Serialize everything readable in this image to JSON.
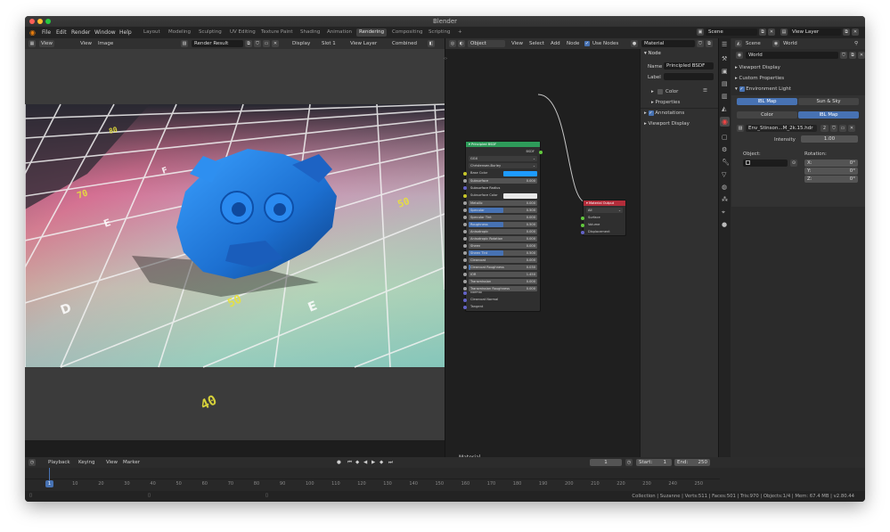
{
  "app": {
    "title": "Blender"
  },
  "menu": [
    "File",
    "Edit",
    "Render",
    "Window",
    "Help"
  ],
  "workspaces": [
    "Layout",
    "Modeling",
    "Sculpting",
    "UV Editing",
    "Texture Paint",
    "Shading",
    "Animation",
    "Rendering",
    "Compositing",
    "Scripting"
  ],
  "active_workspace": "Rendering",
  "top_right": {
    "scene": "Scene",
    "view_layer": "View Layer"
  },
  "image_editor": {
    "menus": [
      "View",
      "View",
      "Image"
    ],
    "image_name": "Render Result",
    "display": "Display",
    "slot": "Slot 1",
    "view_layer": "View Layer",
    "pass": "Combined"
  },
  "node_editor": {
    "type": "Object",
    "menus": [
      "View",
      "Select",
      "Add",
      "Node"
    ],
    "use_nodes_label": "Use Nodes",
    "use_nodes": true,
    "material": "Material",
    "footer_label": "Material",
    "bsdf_node": {
      "title": "Principled BSDF",
      "output": "BSDF",
      "distribution": "GGX",
      "subsurface_method": "Christensen-Burley",
      "base_color_label": "Base Color",
      "base_color": "#1e9bff",
      "subsurface_color_label": "Subsurface Color",
      "rows": [
        {
          "label": "Subsurface",
          "value": "0.000",
          "fill": 0
        },
        {
          "label": "Subsurface Radius",
          "value": "",
          "fill": 0
        },
        {
          "label": "Metallic",
          "value": "0.000",
          "fill": 0
        },
        {
          "label": "Specular",
          "value": "0.500",
          "fill": 0.5
        },
        {
          "label": "Specular Tint",
          "value": "0.000",
          "fill": 0
        },
        {
          "label": "Roughness",
          "value": "0.500",
          "fill": 0.5
        },
        {
          "label": "Anisotropic",
          "value": "0.000",
          "fill": 0
        },
        {
          "label": "Anisotropic Rotation",
          "value": "0.000",
          "fill": 0
        },
        {
          "label": "Sheen",
          "value": "0.000",
          "fill": 0
        },
        {
          "label": "Sheen Tint",
          "value": "0.500",
          "fill": 0.5
        },
        {
          "label": "Clearcoat",
          "value": "0.000",
          "fill": 0
        },
        {
          "label": "Clearcoat Roughness",
          "value": "0.030",
          "fill": 0.03
        },
        {
          "label": "IOR",
          "value": "1.450",
          "fill": 0
        },
        {
          "label": "Transmission",
          "value": "0.000",
          "fill": 0
        },
        {
          "label": "Transmission Roughness",
          "value": "0.000",
          "fill": 0
        }
      ],
      "inputs": [
        "Normal",
        "Clearcoat Normal",
        "Tangent"
      ]
    },
    "output_node": {
      "title": "Material Output",
      "target": "All",
      "inputs": [
        "Surface",
        "Volume",
        "Displacement"
      ]
    },
    "sidebar": {
      "panel": "Node",
      "name_label": "Name",
      "name": "Principled BSDF",
      "label_label": "Label",
      "label_value": "",
      "color_label": "Color",
      "properties_label": "Properties",
      "annotations_label": "Annotations",
      "viewport_display_label": "Viewport Display"
    }
  },
  "properties": {
    "scene": "Scene",
    "world": "World",
    "world_name": "World",
    "panels": [
      "Viewport Display",
      "Custom Properties",
      "Environment Light"
    ],
    "environment_light_enabled": true,
    "tabs_top": [
      "IBL Map",
      "Sun & Sky"
    ],
    "tabs_sub": [
      "Color",
      "IBL Map"
    ],
    "ibl_file": "Env_Stinson...M_2k.15.hdr",
    "ibl_users": "2",
    "intensity_label": "Intensity",
    "intensity": "1.00",
    "object_label": "Object:",
    "rotation_label": "Rotation:",
    "rotation": [
      {
        "axis": "X:",
        "value": "0°"
      },
      {
        "axis": "Y:",
        "value": "0°"
      },
      {
        "axis": "Z:",
        "value": "0°"
      }
    ]
  },
  "timeline": {
    "menus": [
      "Playback",
      "Keying",
      "View",
      "Marker"
    ],
    "current_frame": "1",
    "start_label": "Start:",
    "start": "1",
    "end_label": "End:",
    "end": "250",
    "ruler": [
      "10",
      "20",
      "30",
      "40",
      "50",
      "60",
      "70",
      "80",
      "90",
      "100",
      "110",
      "120",
      "130",
      "140",
      "150",
      "160",
      "170",
      "180",
      "190",
      "200",
      "210",
      "220",
      "230",
      "240",
      "250"
    ],
    "playhead": "1"
  },
  "status_bar": {
    "text": "Collection | Suzanne | Verts:511 | Faces:501 | Tris:970 | Objects:1/4 | Mem: 67.4 MB | v2.80.44"
  },
  "colors": {
    "accent": "#4772b3",
    "bsdf_header": "#2e9b5a",
    "output_header": "#b32d3a",
    "shader_socket": "#62c93e",
    "color_socket": "#c7c729",
    "vector_socket": "#6363c7",
    "value_socket": "#a1a1a1"
  },
  "icons": [
    "blender-logo-icon",
    "editor-type-icon",
    "image-icon",
    "new-image-icon",
    "open-image-icon",
    "close-icon",
    "node-tree-icon",
    "material-sphere-icon",
    "scene-icon",
    "world-icon",
    "pin-icon",
    "list-icon",
    "stop-icon",
    "play-icon",
    "jump-start-icon",
    "jump-end-icon",
    "prev-keyframe-icon",
    "next-keyframe-icon",
    "clock-icon"
  ]
}
